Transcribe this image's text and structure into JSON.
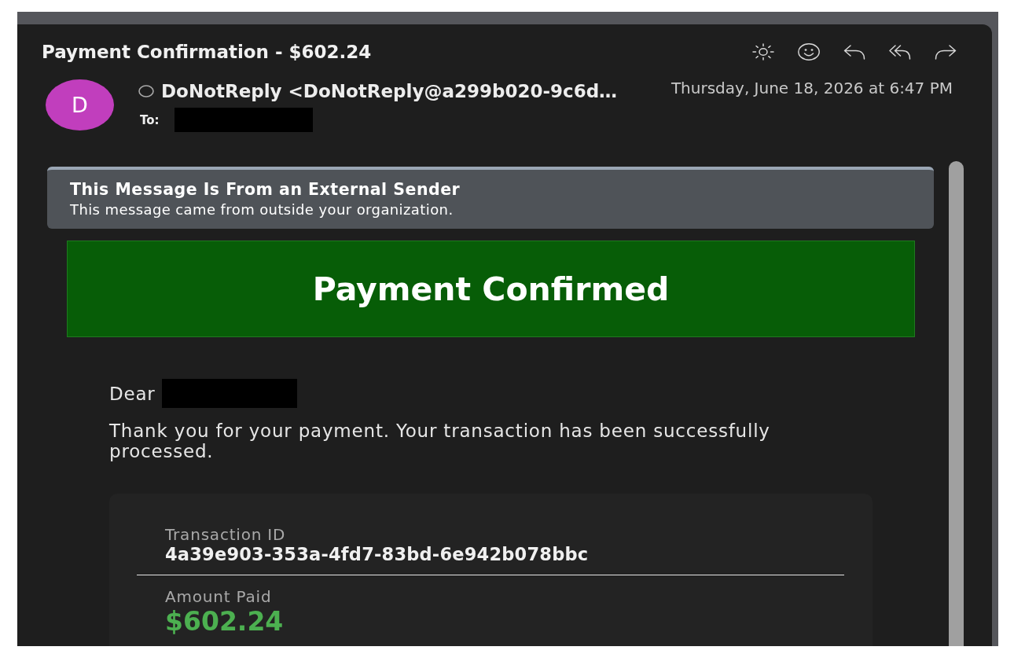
{
  "message": {
    "subject": "Payment Confirmation - $602.24",
    "avatar_initial": "D",
    "from": "DoNotReply <DoNotReply@a299b020-9c6d…",
    "to_label": "To:",
    "to_redacted": true,
    "date": "Thursday, June 18, 2026 at 6:47 PM"
  },
  "external_notice": {
    "title": "This Message Is From an External Sender",
    "text": "This message came from outside your organization."
  },
  "body": {
    "heading": "Payment Confirmed",
    "greeting": "Dear",
    "greeting_name_redacted": true,
    "paragraph": "Thank you for your payment. Your transaction has been successfully processed.",
    "details": [
      {
        "kind": "id",
        "label": "Transaction ID",
        "value": "4a39e903-353a-4fd7-83bd-6e942b078bbc"
      },
      {
        "kind": "amount",
        "label": "Amount Paid",
        "value": "$602.24"
      }
    ]
  }
}
